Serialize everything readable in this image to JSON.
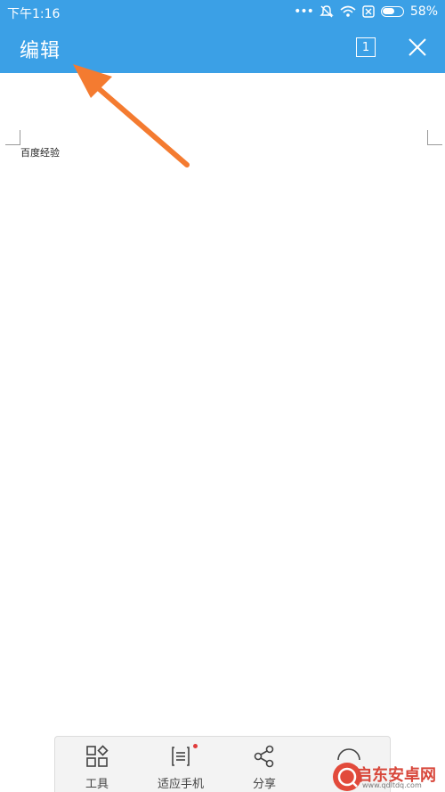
{
  "status_bar": {
    "time": "下午1:16",
    "battery": "58%"
  },
  "toolbar": {
    "title": "编辑",
    "page_count": "1"
  },
  "document": {
    "text": "百度经验"
  },
  "bottom_toolbar": {
    "items": [
      {
        "label": "工具",
        "icon": "grid-tools-icon"
      },
      {
        "label": "适应手机",
        "icon": "fit-phone-icon"
      },
      {
        "label": "分享",
        "icon": "share-icon"
      }
    ]
  },
  "watermark": {
    "name": "启东安卓网",
    "url": "www.qdltdq.com"
  },
  "colors": {
    "accent": "#3ba0e6",
    "arrow": "#f47b30"
  }
}
